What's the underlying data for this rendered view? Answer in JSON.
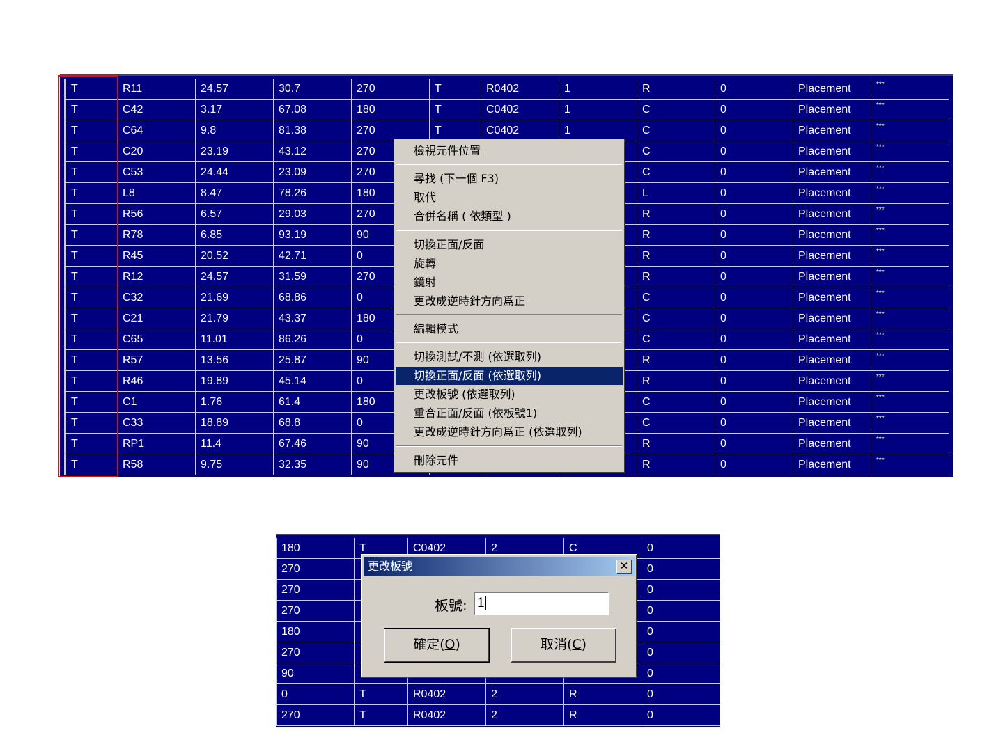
{
  "top_grid": {
    "rows": [
      [
        "T",
        "R11",
        "24.57",
        "30.7",
        "270",
        "T",
        "R0402",
        "1",
        "R",
        "0",
        "Placement",
        "***"
      ],
      [
        "T",
        "C42",
        "3.17",
        "67.08",
        "180",
        "T",
        "C0402",
        "1",
        "C",
        "0",
        "Placement",
        "***"
      ],
      [
        "T",
        "C64",
        "9.8",
        "81.38",
        "270",
        "T",
        "C0402",
        "1",
        "C",
        "0",
        "Placement",
        "***"
      ],
      [
        "T",
        "C20",
        "23.19",
        "43.12",
        "270",
        "",
        "",
        "",
        "C",
        "0",
        "Placement",
        "***"
      ],
      [
        "T",
        "C53",
        "24.44",
        "23.09",
        "270",
        "",
        "",
        "",
        "C",
        "0",
        "Placement",
        "***"
      ],
      [
        "T",
        "L8",
        "8.47",
        "78.26",
        "180",
        "",
        "",
        "",
        "L",
        "0",
        "Placement",
        "***"
      ],
      [
        "T",
        "R56",
        "6.57",
        "29.03",
        "270",
        "",
        "",
        "",
        "R",
        "0",
        "Placement",
        "***"
      ],
      [
        "T",
        "R78",
        "6.85",
        "93.19",
        "90",
        "",
        "",
        "",
        "R",
        "0",
        "Placement",
        "***"
      ],
      [
        "T",
        "R45",
        "20.52",
        "42.71",
        "0",
        "",
        "",
        "",
        "R",
        "0",
        "Placement",
        "***"
      ],
      [
        "T",
        "R12",
        "24.57",
        "31.59",
        "270",
        "",
        "",
        "",
        "R",
        "0",
        "Placement",
        "***"
      ],
      [
        "T",
        "C32",
        "21.69",
        "68.86",
        "0",
        "",
        "",
        "",
        "C",
        "0",
        "Placement",
        "***"
      ],
      [
        "T",
        "C21",
        "21.79",
        "43.37",
        "180",
        "",
        "",
        "",
        "C",
        "0",
        "Placement",
        "***"
      ],
      [
        "T",
        "C65",
        "11.01",
        "86.26",
        "0",
        "",
        "",
        "",
        "C",
        "0",
        "Placement",
        "***"
      ],
      [
        "T",
        "R57",
        "13.56",
        "25.87",
        "90",
        "",
        "",
        "",
        "R",
        "0",
        "Placement",
        "***"
      ],
      [
        "T",
        "R46",
        "19.89",
        "45.14",
        "0",
        "",
        "",
        "",
        "R",
        "0",
        "Placement",
        "***"
      ],
      [
        "T",
        "C1",
        "1.76",
        "61.4",
        "180",
        "",
        "",
        "",
        "C",
        "0",
        "Placement",
        "***"
      ],
      [
        "T",
        "C33",
        "18.89",
        "68.8",
        "0",
        "",
        "",
        "",
        "C",
        "0",
        "Placement",
        "***"
      ],
      [
        "T",
        "RP1",
        "11.4",
        "67.46",
        "90",
        "",
        "",
        "",
        "R",
        "0",
        "Placement",
        "***"
      ],
      [
        "T",
        "R58",
        "9.75",
        "32.35",
        "90",
        "",
        "",
        "",
        "R",
        "0",
        "Placement",
        "***"
      ]
    ]
  },
  "context_menu": {
    "items": [
      {
        "label": "檢視元件位置",
        "highlighted": false
      },
      {
        "label": "尋找 (下一個 F3)",
        "highlighted": false
      },
      {
        "label": "取代",
        "highlighted": false
      },
      {
        "label": "合併名稱 ( 依類型 )",
        "highlighted": false
      },
      {
        "label": "切換正面/反面",
        "highlighted": false
      },
      {
        "label": "旋轉",
        "highlighted": false
      },
      {
        "label": "鏡射",
        "highlighted": false
      },
      {
        "label": "更改成逆時針方向爲正",
        "highlighted": false
      },
      {
        "label": "編輯模式",
        "highlighted": false
      },
      {
        "label": "切換測試/不測 (依選取列)",
        "highlighted": false
      },
      {
        "label": "切換正面/反面 (依選取列)",
        "highlighted": true
      },
      {
        "label": "更改板號 (依選取列)",
        "highlighted": false
      },
      {
        "label": "重合正面/反面 (依板號1)",
        "highlighted": false
      },
      {
        "label": "更改成逆時針方向爲正 (依選取列)",
        "highlighted": false
      },
      {
        "label": "刪除元件",
        "highlighted": false
      }
    ]
  },
  "bottom_grid": {
    "rows": [
      [
        "180",
        "T",
        "C0402",
        "2",
        "C",
        "0"
      ],
      [
        "270",
        "",
        "",
        "",
        "",
        "0"
      ],
      [
        "270",
        "",
        "",
        "",
        "",
        "0"
      ],
      [
        "270",
        "",
        "",
        "",
        "",
        "0"
      ],
      [
        "180",
        "",
        "",
        "",
        "",
        "0"
      ],
      [
        "270",
        "",
        "",
        "",
        "",
        "0"
      ],
      [
        "90",
        "",
        "",
        "",
        "",
        "0"
      ],
      [
        "0",
        "T",
        "R0402",
        "2",
        "R",
        "0"
      ],
      [
        "270",
        "T",
        "R0402",
        "2",
        "R",
        "0"
      ]
    ]
  },
  "dialog": {
    "title": "更改板號",
    "close_glyph": "✕",
    "field_label": "板號:",
    "field_value": "1",
    "ok_text": "確定(",
    "ok_key": "O",
    "cancel_text": "取消(",
    "cancel_key": "C",
    "paren_close": ")"
  },
  "colors": {
    "grid_background": "#000080",
    "selection_box": "#e01010",
    "menu_highlight": "#0a246a",
    "dialog_face": "#d4d0c8"
  }
}
